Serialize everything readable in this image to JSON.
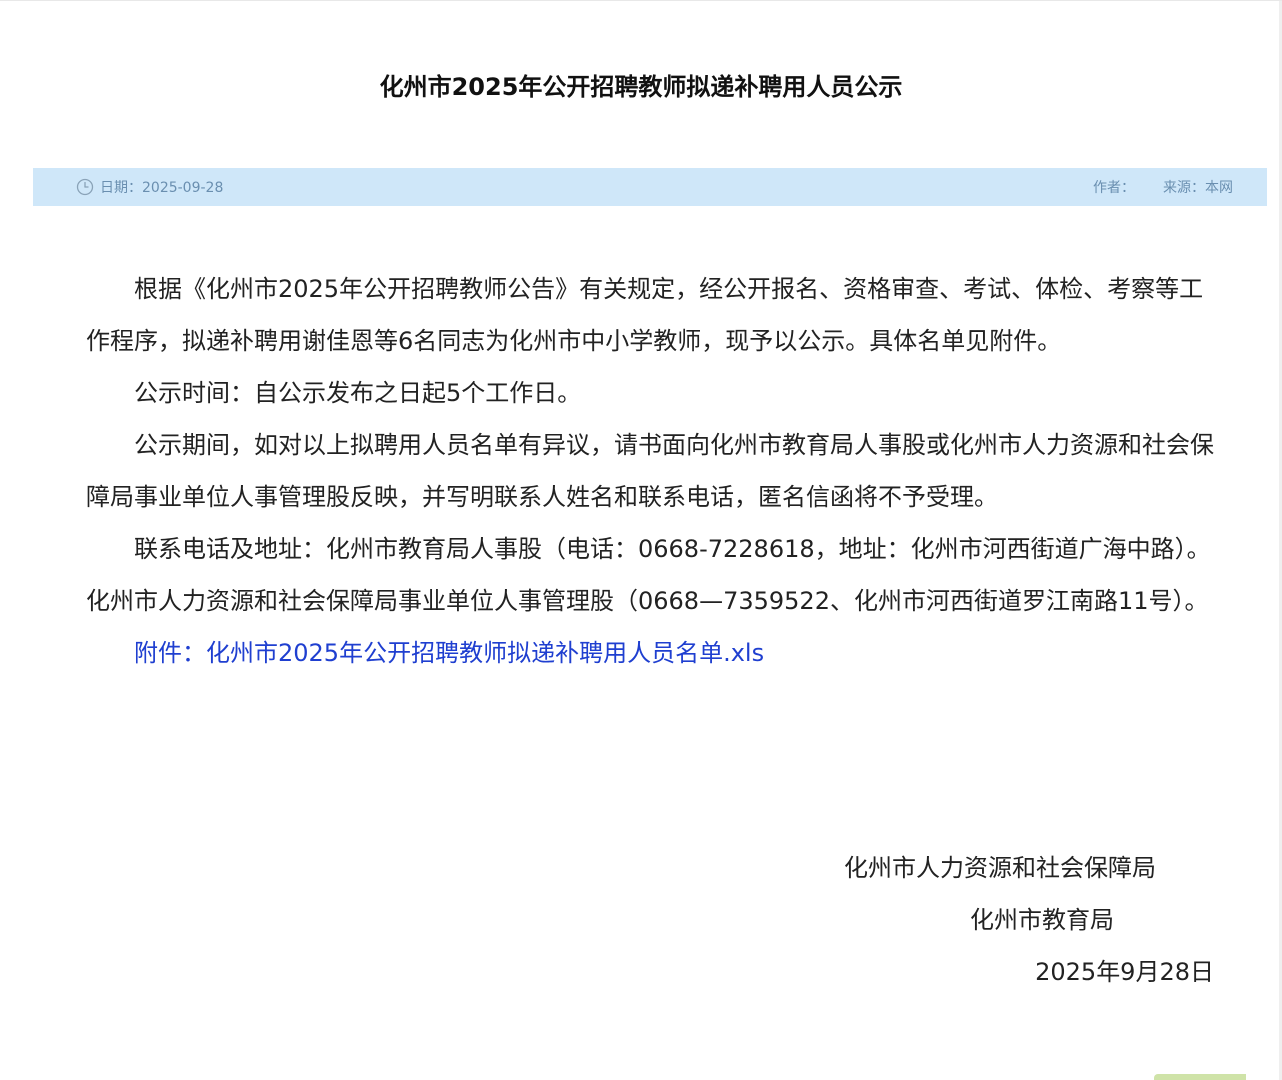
{
  "article": {
    "title": "化州市2025年公开招聘教师拟递补聘用人员公示",
    "meta": {
      "date_label": "日期：2025-09-28",
      "author_label": "作者：",
      "source_label": "来源：",
      "source_value": "本网"
    },
    "paragraphs": [
      "根据《化州市2025年公开招聘教师公告》有关规定，经公开报名、资格审查、考试、体检、考察等工作程序，拟递补聘用谢佳恩等6名同志为化州市中小学教师，现予以公示。具体名单见附件。",
      "公示时间：自公示发布之日起5个工作日。",
      "公示期间，如对以上拟聘用人员名单有异议，请书面向化州市教育局人事股或化州市人力资源和社会保障局事业单位人事管理股反映，并写明联系人姓名和联系电话，匿名信函将不予受理。",
      "联系电话及地址：化州市教育局人事股（电话：0668-7228618，地址：化州市河西街道广海中路）。化州市人力资源和社会保障局事业单位人事管理股（0668—7359522、化州市河西街道罗江南路11号）。"
    ],
    "attachment": {
      "label": "附件：化州市2025年公开招聘教师拟递补聘用人员名单.xls"
    },
    "signature": {
      "org1": "化州市人力资源和社会保障局",
      "org2": "化州市教育局",
      "date": "2025年9月28日"
    }
  },
  "icons": {
    "date": "clock-icon"
  },
  "colors": {
    "meta_bar_bg": "#cfe7f9",
    "meta_text": "#6a8fb0",
    "link": "#1f3fd0"
  }
}
